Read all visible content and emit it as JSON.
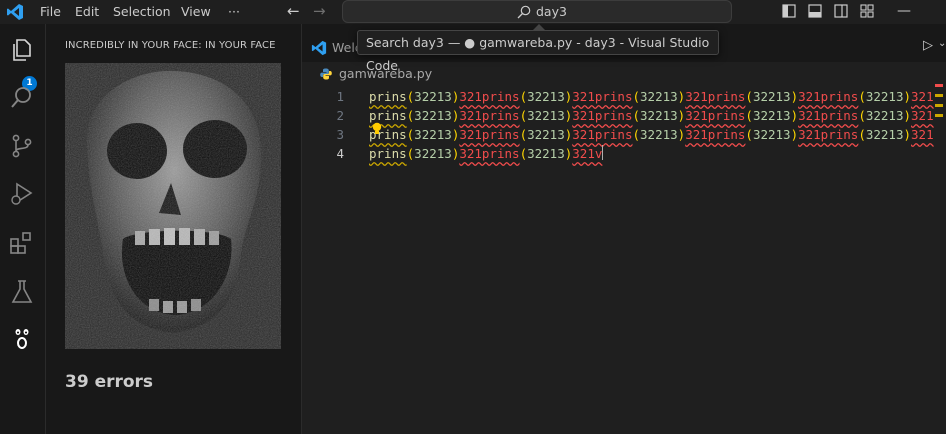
{
  "titlebar": {
    "menus": [
      "File",
      "Edit",
      "Selection",
      "View",
      "···"
    ],
    "search_text": "day3"
  },
  "tooltip": {
    "text": "Search day3 — ● gamwareba.py - day3 - Visual Studio Code"
  },
  "activitybar": {
    "icons": [
      "explorer-icon",
      "search-icon",
      "source-control-icon",
      "run-debug-icon",
      "extensions-icon",
      "testing-icon",
      "ghost-face-icon"
    ],
    "badge": "1",
    "accent_color": "#0078d4"
  },
  "sidebar": {
    "title": "INCREDIBLY IN YOUR FACE: IN YOUR FACE",
    "errors_label": "39 errors"
  },
  "editor": {
    "tab_label": "Welc",
    "breadcrumb_file": "gamwareba.py",
    "lines": [
      {
        "number": "1",
        "segments": 5
      },
      {
        "number": "2",
        "segments": 5
      },
      {
        "number": "3",
        "segments": 5
      },
      {
        "number": "4",
        "segments": 2,
        "trailing": "321v"
      }
    ],
    "segment_fn": "prins",
    "segment_arg": "32213",
    "segment_tail": "321",
    "colors": {
      "fn": "#dcdcaa",
      "num": "#b5cea8",
      "error": "#f14c4c"
    }
  }
}
